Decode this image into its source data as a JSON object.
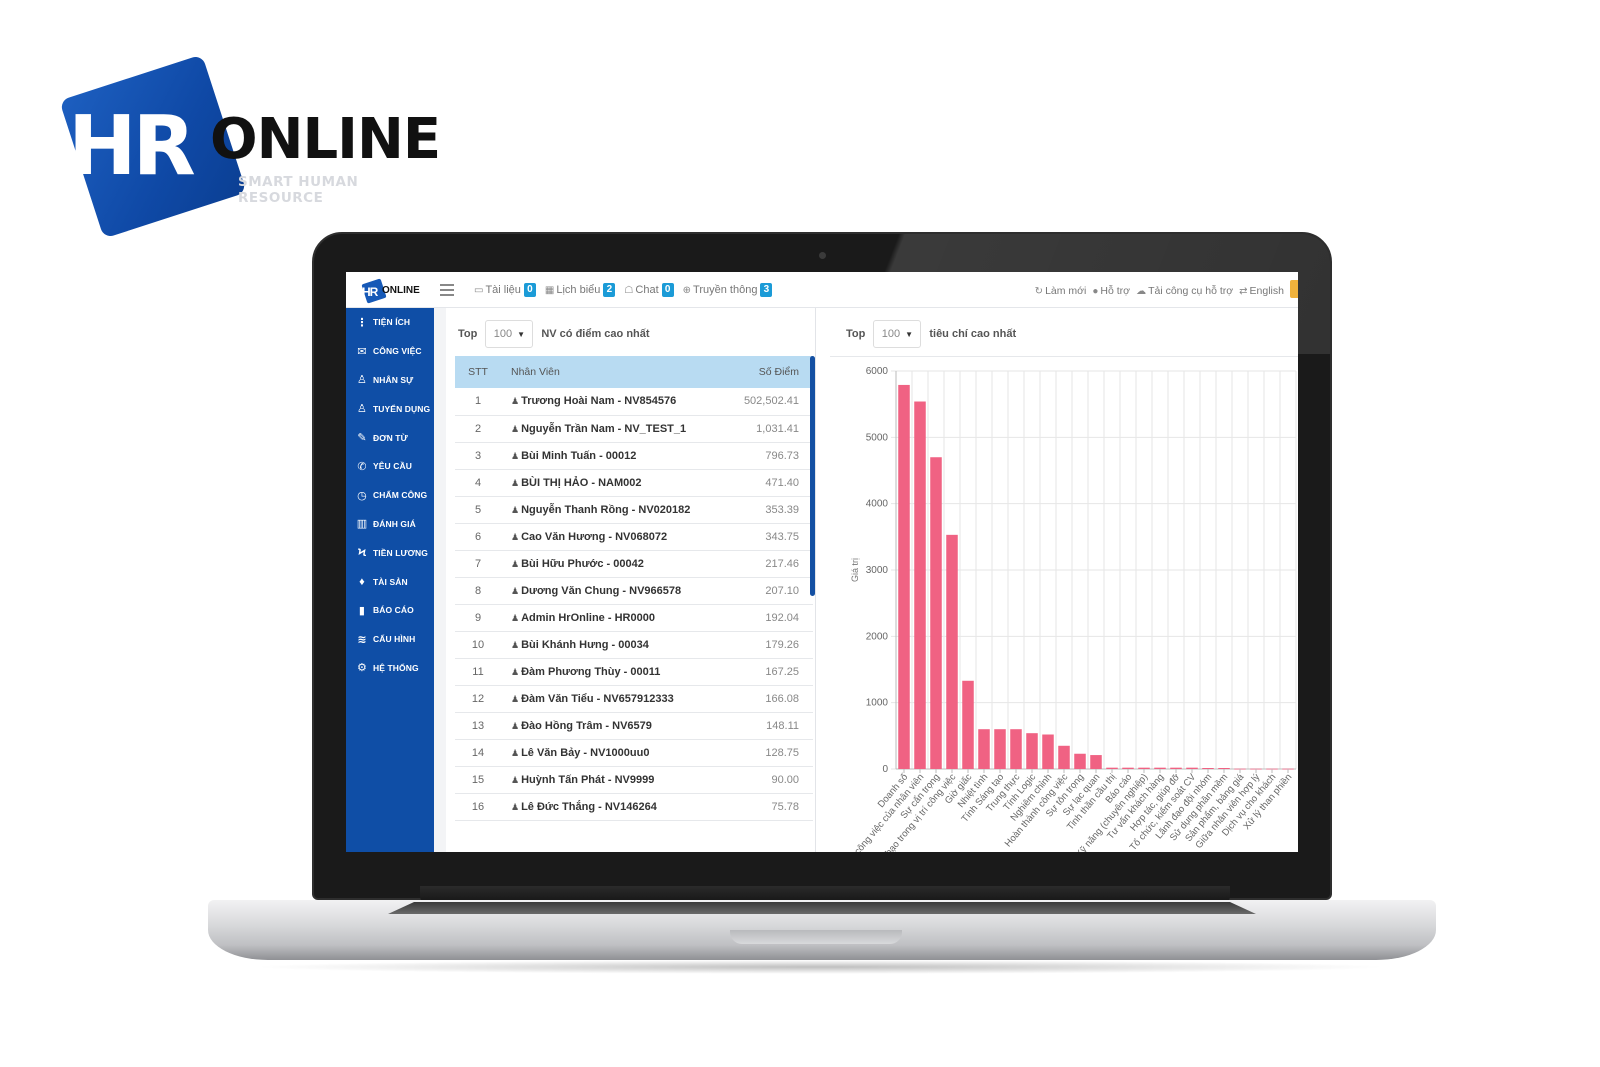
{
  "brand": {
    "hr": "HR",
    "online": "ONLINE",
    "tagline": "SMART HUMAN RESOURCE",
    "primary_color": "#0f4ea6"
  },
  "topbar": {
    "mini_logo": {
      "hr": "HR",
      "online": "ONLINE"
    },
    "menu_icon": "hamburger-icon",
    "links": [
      {
        "icon": "folder-icon",
        "label": "Tài liệu",
        "badge": "0"
      },
      {
        "icon": "calendar-icon",
        "label": "Lịch biểu",
        "badge": "2"
      },
      {
        "icon": "chat-icon",
        "label": "Chat",
        "badge": "0"
      },
      {
        "icon": "globe-icon",
        "label": "Truyền thông",
        "badge": "3"
      }
    ],
    "right_links": [
      {
        "icon": "refresh-icon",
        "label": "Làm mới"
      },
      {
        "icon": "info-icon",
        "label": "Hỗ trợ"
      },
      {
        "icon": "cloud-download-icon",
        "label": "Tải công cụ hỗ trợ"
      },
      {
        "icon": "language-icon",
        "label": "English"
      }
    ]
  },
  "sidebar": {
    "items": [
      {
        "icon": "more-vertical-icon",
        "label": "Tiện ích"
      },
      {
        "icon": "inbox-icon",
        "label": "Công việc"
      },
      {
        "icon": "user-icon",
        "label": "Nhân sự"
      },
      {
        "icon": "user-plus-icon",
        "label": "Tuyển dụng"
      },
      {
        "icon": "edit-icon",
        "label": "Đơn từ"
      },
      {
        "icon": "phone-icon",
        "label": "Yêu cầu"
      },
      {
        "icon": "clock-icon",
        "label": "Chấm công"
      },
      {
        "icon": "book-icon",
        "label": "Đánh giá"
      },
      {
        "icon": "bolt-icon",
        "label": "Tiền lương"
      },
      {
        "icon": "diamond-icon",
        "label": "Tài sản"
      },
      {
        "icon": "bar-chart-icon",
        "label": "Báo cáo"
      },
      {
        "icon": "layers-icon",
        "label": "Cấu hình"
      },
      {
        "icon": "gear-icon",
        "label": "Hệ thống"
      }
    ]
  },
  "left_panel": {
    "top_label": "Top",
    "top_value": "100",
    "title": "NV có điểm cao nhất",
    "columns": [
      "STT",
      "Nhân Viên",
      "Số Điểm"
    ],
    "rows": [
      {
        "stt": "1",
        "name": "Trương Hoài Nam - NV854576",
        "score": "502,502.41"
      },
      {
        "stt": "2",
        "name": "Nguyễn Trần Nam - NV_TEST_1",
        "score": "1,031.41"
      },
      {
        "stt": "3",
        "name": "Bùi Minh Tuấn - 00012",
        "score": "796.73"
      },
      {
        "stt": "4",
        "name": "BÙI THỊ HẢO - NAM002",
        "score": "471.40"
      },
      {
        "stt": "5",
        "name": "Nguyễn Thanh Rồng - NV020182",
        "score": "353.39"
      },
      {
        "stt": "6",
        "name": "Cao Văn Hương - NV068072",
        "score": "343.75"
      },
      {
        "stt": "7",
        "name": "Bùi Hữu Phước - 00042",
        "score": "217.46"
      },
      {
        "stt": "8",
        "name": "Dương Văn Chung - NV966578",
        "score": "207.10"
      },
      {
        "stt": "9",
        "name": "Admin HrOnline - HR0000",
        "score": "192.04"
      },
      {
        "stt": "10",
        "name": "Bùi Khánh Hưng - 00034",
        "score": "179.26"
      },
      {
        "stt": "11",
        "name": "Đàm Phương Thùy - 00011",
        "score": "167.25"
      },
      {
        "stt": "12",
        "name": "Đàm Văn Tiểu - NV657912333",
        "score": "166.08"
      },
      {
        "stt": "13",
        "name": "Đào Hồng Trâm - NV6579",
        "score": "148.11"
      },
      {
        "stt": "14",
        "name": "Lê Văn Bảy - NV1000uu0",
        "score": "128.75"
      },
      {
        "stt": "15",
        "name": "Huỳnh Tấn Phát - NV9999",
        "score": "90.00"
      },
      {
        "stt": "16",
        "name": "Lê Đức Thắng - NV146264",
        "score": "75.78"
      }
    ]
  },
  "right_panel": {
    "top_label": "Top",
    "top_value": "100",
    "title": "tiêu chí cao nhất"
  },
  "chart_data": {
    "type": "bar",
    "title": "",
    "xlabel": "",
    "ylabel": "Giá trị",
    "ylim": [
      0,
      6000
    ],
    "yticks": [
      0,
      1000,
      2000,
      3000,
      4000,
      5000,
      6000
    ],
    "grid": true,
    "bar_color": "#f06283",
    "categories": [
      "Doanh số",
      "Kết quả công việc của nhân viên",
      "Sự cẩn trọng",
      "Thành thạo trong vị trí công việc",
      "Giờ giấc",
      "Nhiệt tình",
      "Tính Sáng tạo",
      "Trung thực",
      "Tính Logic",
      "Nghiêm chỉnh",
      "Hoàn thành công việc",
      "Sự tôn trọng",
      "Sự lạc quan",
      "Tinh thần cầu thị",
      "Báo cáo",
      "Kỹ năng (chuyên nghiệp)",
      "Tư vấn khách hàng",
      "Hợp tác, giúp đỡ",
      "Tổ chức, kiểm soát CV",
      "Lãnh đạo đội nhóm",
      "Sử dụng phần mềm",
      "Sản phẩm, bảng giá",
      "Giữa nhân viên hợp lý",
      "Dịch vụ cho khách",
      "Xử lý than phiền"
    ],
    "values": [
      5790,
      5540,
      4700,
      3530,
      1330,
      600,
      600,
      600,
      540,
      520,
      350,
      230,
      210,
      20,
      20,
      20,
      20,
      20,
      20,
      15,
      15,
      5,
      5,
      5,
      5
    ]
  }
}
